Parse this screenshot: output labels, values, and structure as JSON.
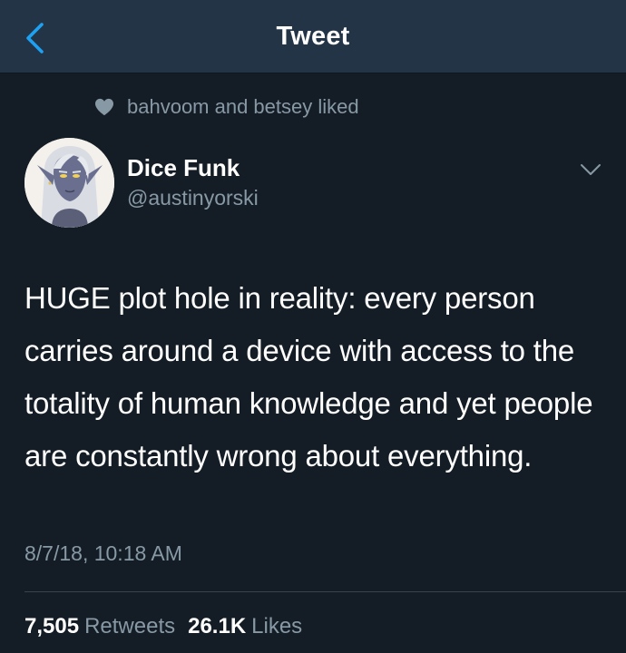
{
  "colors": {
    "background": "#141d26",
    "navbar": "#243447",
    "accent": "#1da1f2",
    "secondary_text": "#8899a6",
    "primary_text": "#ffffff"
  },
  "header": {
    "title": "Tweet",
    "back_icon": "chevron-left-icon"
  },
  "social_context": {
    "icon": "heart-icon",
    "text": "bahvoom and betsey liked"
  },
  "author": {
    "name": "Dice Funk",
    "handle": "@austinyorski",
    "avatar_icon": "avatar-drow-elf-illustration"
  },
  "menu_icon": "chevron-down-icon",
  "tweet": {
    "text": "HUGE plot hole in reality: every person carries around a device with access to the totality of human knowledge and yet people are constantly wrong about everything.",
    "timestamp": "8/7/18, 10:18 AM"
  },
  "stats": {
    "retweets_count": "7,505",
    "retweets_label": "Retweets",
    "likes_count": "26.1K",
    "likes_label": "Likes"
  }
}
